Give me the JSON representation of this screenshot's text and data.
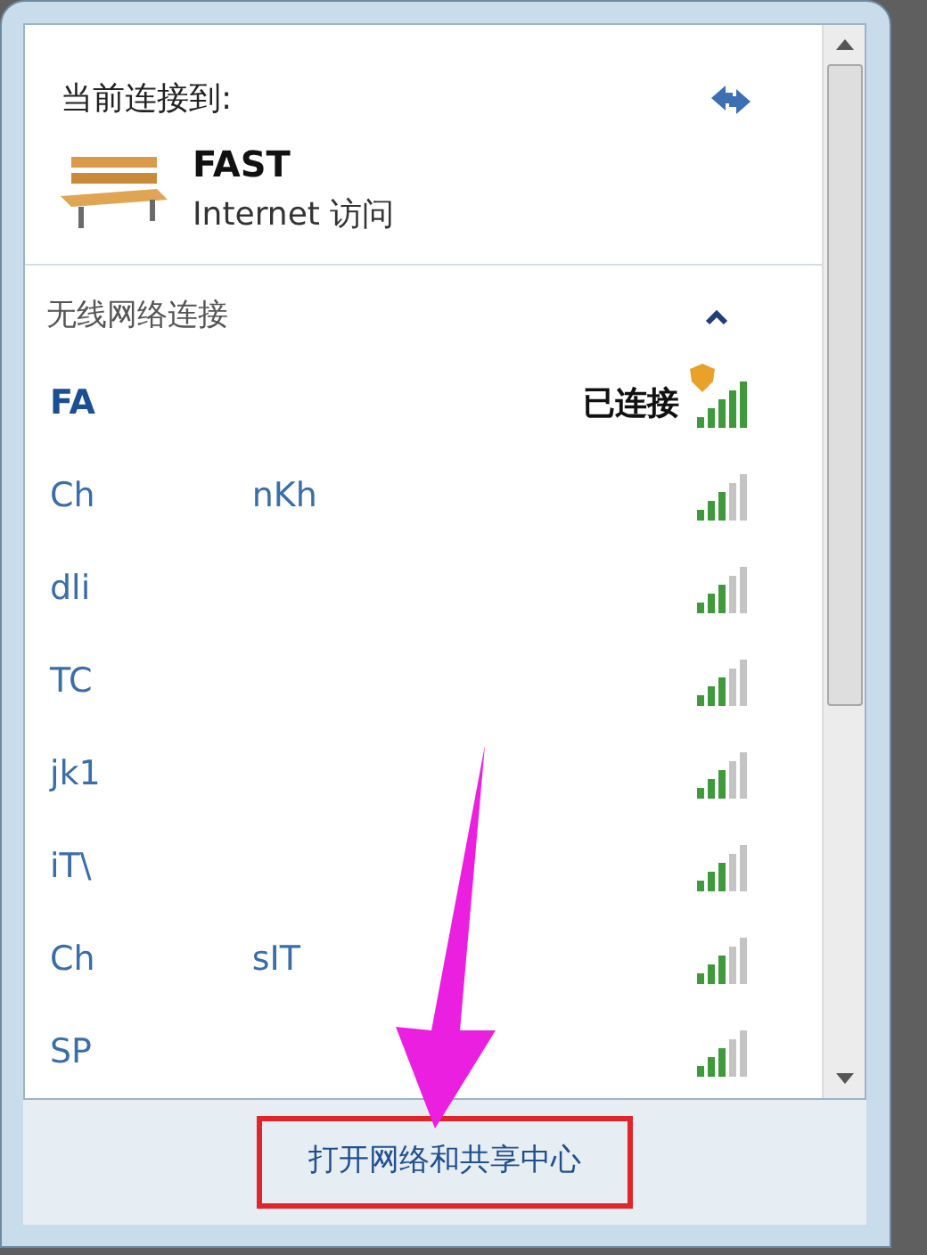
{
  "current": {
    "label": "当前连接到:",
    "network": "FAST",
    "access": "Internet 访问"
  },
  "section": {
    "title": "无线网络连接",
    "expanded": true
  },
  "networks": [
    {
      "name_parts": [
        "FA"
      ],
      "status": "已连接",
      "secured": true,
      "selected": true
    },
    {
      "name_parts": [
        "Ch",
        "nKh"
      ],
      "selected": false
    },
    {
      "name_parts": [
        "dli"
      ],
      "selected": false
    },
    {
      "name_parts": [
        "TC"
      ],
      "selected": false
    },
    {
      "name_parts": [
        "jk1"
      ],
      "selected": false
    },
    {
      "name_parts": [
        "iT\\"
      ],
      "selected": false
    },
    {
      "name_parts": [
        "Ch",
        "sIT"
      ],
      "selected": false
    },
    {
      "name_parts": [
        "SP"
      ],
      "selected": false
    }
  ],
  "footer": {
    "link": "打开网络和共享中心"
  }
}
